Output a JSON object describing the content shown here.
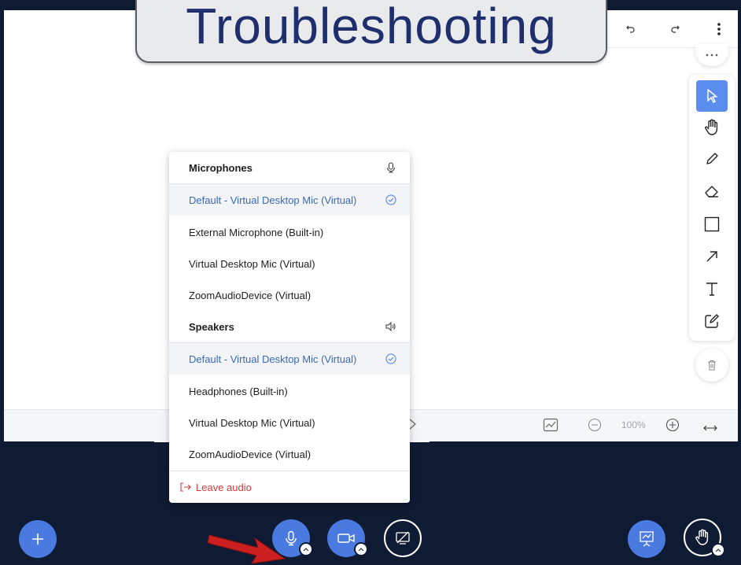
{
  "banner": {
    "text": "Troubleshooting"
  },
  "zoom": {
    "level": "100%"
  },
  "audio_menu": {
    "microphones_header": "Microphones",
    "microphones": [
      {
        "label": "Default - Virtual Desktop Mic (Virtual)",
        "selected": true
      },
      {
        "label": "External Microphone (Built-in)",
        "selected": false
      },
      {
        "label": "Virtual Desktop Mic (Virtual)",
        "selected": false
      },
      {
        "label": "ZoomAudioDevice (Virtual)",
        "selected": false
      }
    ],
    "speakers_header": "Speakers",
    "speakers": [
      {
        "label": "Default - Virtual Desktop Mic (Virtual)",
        "selected": true
      },
      {
        "label": "Headphones (Built-in)",
        "selected": false
      },
      {
        "label": "Virtual Desktop Mic (Virtual)",
        "selected": false
      },
      {
        "label": "ZoomAudioDevice (Virtual)",
        "selected": false
      }
    ],
    "leave_audio": "Leave audio"
  },
  "icons": {
    "undo": "undo-icon",
    "redo": "redo-icon",
    "more": "more-vertical-icon",
    "toolbar": [
      "pointer-icon",
      "hand-icon",
      "pencil-icon",
      "eraser-icon",
      "rectangle-icon",
      "arrow-icon",
      "text-icon",
      "note-icon"
    ],
    "trash": "trash-icon"
  },
  "colors": {
    "accent": "#4a7ae0",
    "selected_text": "#3a69b8",
    "leave": "#cf3b3b",
    "background": "#0f1b33"
  }
}
